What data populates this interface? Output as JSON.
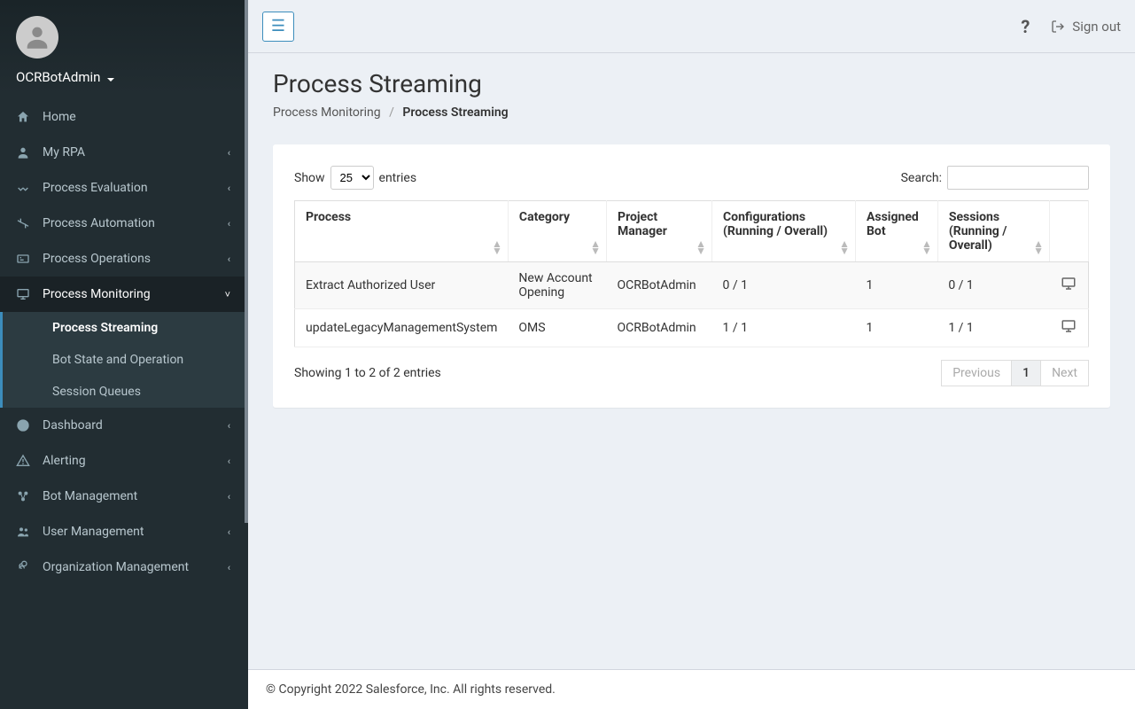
{
  "user": {
    "name": "OCRBotAdmin"
  },
  "topbar": {
    "help_label": "?",
    "signout_label": "Sign out"
  },
  "sidebar": {
    "items": [
      {
        "icon": "home-icon",
        "label": "Home",
        "expandable": false
      },
      {
        "icon": "user-icon",
        "label": "My RPA",
        "expandable": true
      },
      {
        "icon": "check-icon",
        "label": "Process Evaluation",
        "expandable": true
      },
      {
        "icon": "automation-icon",
        "label": "Process Automation",
        "expandable": true
      },
      {
        "icon": "operations-icon",
        "label": "Process Operations",
        "expandable": true
      },
      {
        "icon": "monitoring-icon",
        "label": "Process Monitoring",
        "expandable": true,
        "active": true,
        "subitems": [
          {
            "label": "Process Streaming",
            "active": true
          },
          {
            "label": "Bot State and Operation",
            "active": false
          },
          {
            "label": "Session Queues",
            "active": false
          }
        ]
      },
      {
        "icon": "dashboard-icon",
        "label": "Dashboard",
        "expandable": true
      },
      {
        "icon": "alert-icon",
        "label": "Alerting",
        "expandable": true
      },
      {
        "icon": "bot-icon",
        "label": "Bot Management",
        "expandable": true
      },
      {
        "icon": "users-icon",
        "label": "User Management",
        "expandable": true
      },
      {
        "icon": "org-icon",
        "label": "Organization Management",
        "expandable": true
      }
    ]
  },
  "header": {
    "title": "Process Streaming",
    "breadcrumb_parent": "Process Monitoring",
    "breadcrumb_current": "Process Streaming"
  },
  "table": {
    "length_prefix": "Show",
    "length_value": "25",
    "length_suffix": "entries",
    "search_label": "Search:",
    "search_value": "",
    "columns": {
      "process": "Process",
      "category": "Category",
      "project_manager": "Project Manager",
      "configurations": "Configurations (Running / Overall)",
      "assigned_bot": "Assigned Bot",
      "sessions": "Sessions (Running / Overall)"
    },
    "rows": [
      {
        "process": "Extract Authorized User",
        "category": "New Account Opening",
        "project_manager": "OCRBotAdmin",
        "configurations": "0 / 1",
        "assigned_bot": "1",
        "sessions": "0 / 1"
      },
      {
        "process": "updateLegacyManagementSystem",
        "category": "OMS",
        "project_manager": "OCRBotAdmin",
        "configurations": "1 / 1",
        "assigned_bot": "1",
        "sessions": "1 / 1"
      }
    ],
    "info": "Showing 1 to 2 of 2 entries",
    "pagination": {
      "previous": "Previous",
      "page1": "1",
      "next": "Next"
    }
  },
  "footer": {
    "text": "© Copyright 2022 Salesforce, Inc. All rights reserved."
  }
}
